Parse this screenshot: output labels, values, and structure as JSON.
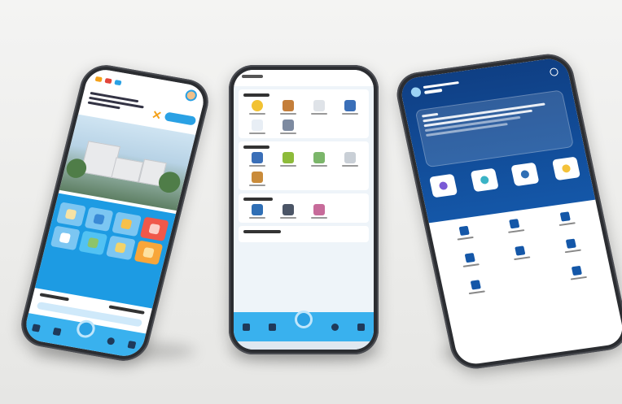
{
  "scene": "three-phone-mockup",
  "phones": [
    {
      "id": "phone-left",
      "theme_color": "#1d9be3"
    },
    {
      "id": "phone-center",
      "theme_color": "#39b1ee"
    },
    {
      "id": "phone-right",
      "theme_color": "#1457a8"
    }
  ],
  "colors": {
    "background": "#ececea",
    "phone_frame": "#2b2d31",
    "accent_blue": "#2aa1e4",
    "navy": "#0f3f84"
  }
}
